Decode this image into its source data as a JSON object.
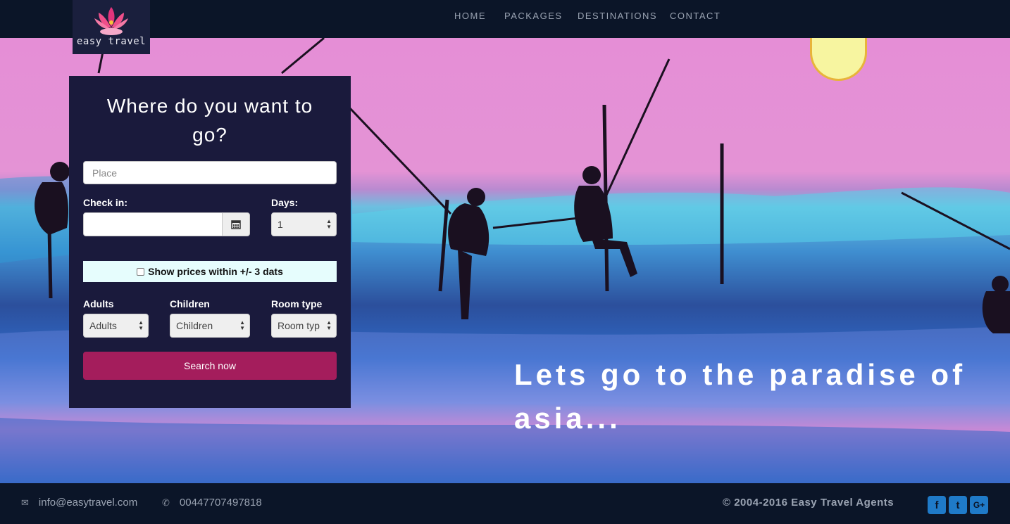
{
  "brand": {
    "name": "easy travel",
    "logo_icon": "lotus-icon",
    "accent": "#e2347c"
  },
  "nav": {
    "items": [
      "HOME",
      "PACKAGES",
      "DESTINATIONS",
      "CONTACT"
    ]
  },
  "search": {
    "title": "Where do you want to go?",
    "place_placeholder": "Place",
    "checkin_label": "Check in:",
    "checkin_value": "",
    "days_label": "Days:",
    "days_value": "1",
    "flex_dates_label": "Show prices within +/- 3 dats",
    "flex_dates_checked": false,
    "adults_label": "Adults",
    "adults_value": "Adults",
    "children_label": "Children",
    "children_value": "Children",
    "room_label": "Room type",
    "room_value": "Room typ",
    "button": "Search now",
    "button_color": "#a41d5c"
  },
  "hero": {
    "tagline": "Lets go to the paradise of asia..."
  },
  "footer": {
    "email": "info@easytravel.com",
    "phone": "00447707497818",
    "copyright": "© 2004-2016 Easy Travel Agents",
    "social": [
      {
        "icon": "facebook-icon",
        "glyph": "f"
      },
      {
        "icon": "twitter-icon",
        "glyph": "t"
      },
      {
        "icon": "google-plus-icon",
        "glyph": "G+"
      }
    ]
  }
}
